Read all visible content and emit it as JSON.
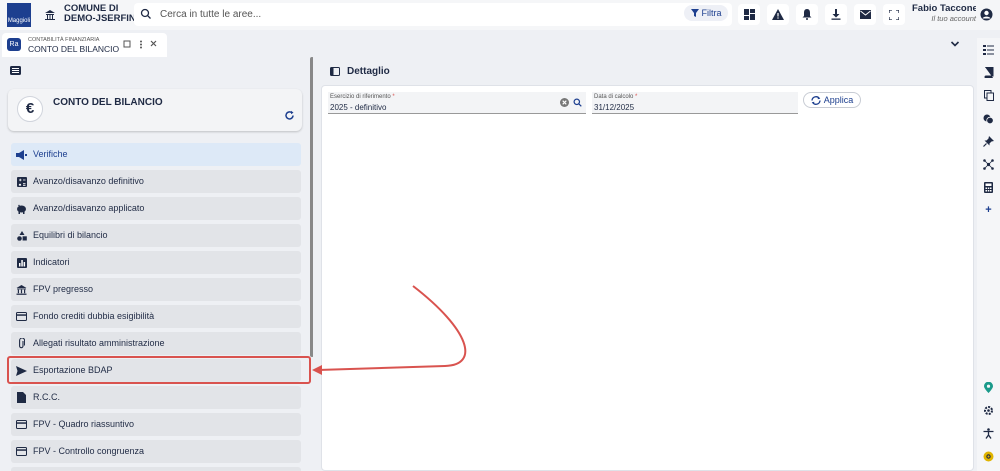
{
  "header": {
    "logo_text": "Maggioli",
    "ente_line1": "COMUNE DI",
    "ente_line2": "DEMO-JSERFIN",
    "search_placeholder": "Cerca in tutte le aree...",
    "filter_label": "Filtra",
    "toolbar_icons": [
      "dashboard-icon",
      "alert-icon",
      "bell-icon",
      "download-icon",
      "mail-icon",
      "fullscreen-icon"
    ],
    "user_name": "Fabio Tacconelli",
    "user_sub": "Il tuo account"
  },
  "tab": {
    "badge": "Ra",
    "subtitle": "CONTABILITÀ FINANZIARIA",
    "title": "CONTO DEL BILANCIO"
  },
  "sidebar": {
    "card_icon": "€",
    "card_title": "CONTO DEL BILANCIO",
    "items": [
      {
        "label": "Verifiche",
        "icon": "megaphone-icon",
        "selected": true
      },
      {
        "label": "Avanzo/disavanzo definitivo",
        "icon": "calculator-icon"
      },
      {
        "label": "Avanzo/disavanzo applicato",
        "icon": "piggy-bank-icon"
      },
      {
        "label": "Equilibri di bilancio",
        "icon": "shapes-icon"
      },
      {
        "label": "Indicatori",
        "icon": "chart-icon"
      },
      {
        "label": "FPV pregresso",
        "icon": "bank-icon"
      },
      {
        "label": "Fondo crediti dubbia esigibilità",
        "icon": "credit-card-icon"
      },
      {
        "label": "Allegati risultato amministrazione",
        "icon": "paperclip-icon"
      },
      {
        "label": "Esportazione BDAP",
        "icon": "send-icon",
        "highlighted": true
      },
      {
        "label": "R.C.C.",
        "icon": "document-icon"
      },
      {
        "label": "FPV - Quadro riassuntivo",
        "icon": "credit-card-icon"
      },
      {
        "label": "FPV - Controllo congruenza",
        "icon": "credit-card-icon"
      }
    ]
  },
  "detail": {
    "title": "Dettaglio",
    "esercizio_label": "Esercizio di riferimento",
    "esercizio_value": "2025 - definitivo",
    "data_label": "Data di calcolo",
    "data_value": "31/12/2025",
    "required_mark": "*",
    "apply_label": "Applica"
  },
  "right_rail_icons": [
    "list-icon",
    "book-icon",
    "copy-icon",
    "coins-icon",
    "pin-icon",
    "network-icon",
    "calculator-icon",
    "plus-icon",
    "location-icon",
    "settings-icon",
    "accessibility-icon",
    "help-icon"
  ],
  "colors": {
    "accent": "#1d3f8f",
    "highlight": "#d9534f",
    "selected_bg": "#dde9f7"
  }
}
